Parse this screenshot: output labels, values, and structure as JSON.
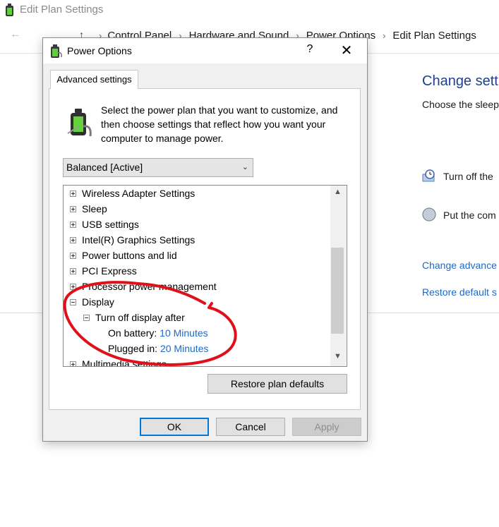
{
  "background_window": {
    "title": "Edit Plan Settings",
    "breadcrumbs": [
      "Control Panel",
      "Hardware and Sound",
      "Power Options",
      "Edit Plan Settings"
    ],
    "heading": "Change setti",
    "subheading": "Choose the sleep",
    "rows": [
      {
        "icon": "display-timer-icon",
        "label": "Turn off the"
      },
      {
        "icon": "sleep-moon-icon",
        "label": "Put the com"
      }
    ],
    "links": [
      "Change advance",
      "Restore default s"
    ]
  },
  "dialog": {
    "title": "Power Options",
    "help_label": "?",
    "close_label": "✕",
    "tab_label": "Advanced settings",
    "description": "Select the power plan that you want to customize, and then choose settings that reflect how you want your computer to manage power.",
    "plan_selected": "Balanced [Active]",
    "tree": {
      "items": [
        {
          "label": "Wireless Adapter Settings",
          "expanded": false
        },
        {
          "label": "Sleep",
          "expanded": false
        },
        {
          "label": "USB settings",
          "expanded": false
        },
        {
          "label": "Intel(R) Graphics Settings",
          "expanded": false
        },
        {
          "label": "Power buttons and lid",
          "expanded": false
        },
        {
          "label": "PCI Express",
          "expanded": false
        },
        {
          "label": "Processor power management",
          "expanded": false
        },
        {
          "label": "Display",
          "expanded": true
        },
        {
          "label": "Turn off display after",
          "expanded": true
        },
        {
          "label": "On battery:",
          "value": "10 Minutes"
        },
        {
          "label": "Plugged in:",
          "value": "20 Minutes"
        },
        {
          "label": "Multimedia settings",
          "expanded": false
        }
      ]
    },
    "restore_button": "Restore plan defaults",
    "ok_button": "OK",
    "cancel_button": "Cancel",
    "apply_button": "Apply"
  },
  "colors": {
    "link_blue": "#1d69c6",
    "heading_blue": "#1e3f8f",
    "focus_blue": "#0078d7",
    "annotation_red": "#e0101a"
  }
}
